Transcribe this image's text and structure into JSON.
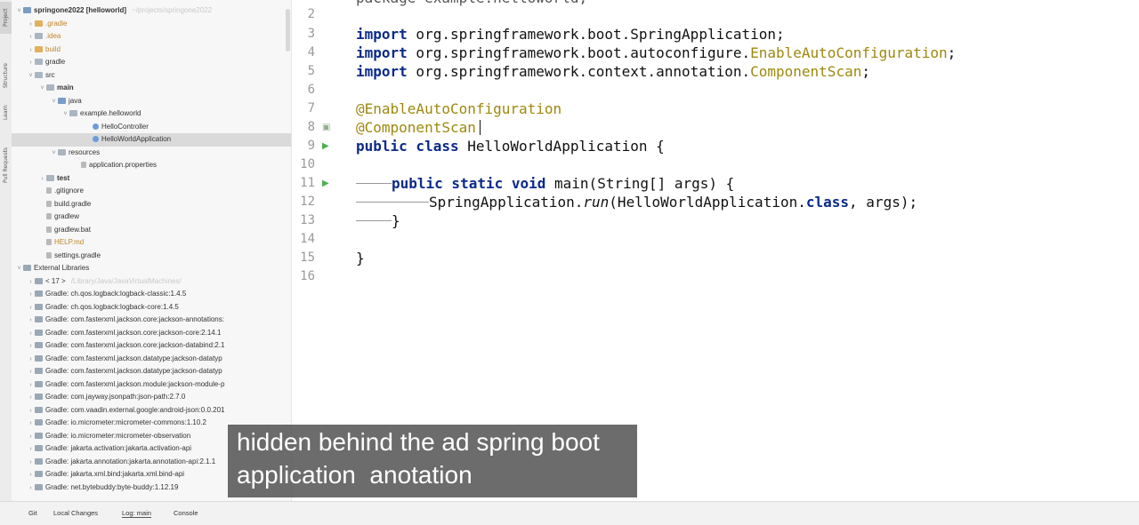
{
  "sidebar_tabs": [
    "Project",
    "Structure",
    "Learn",
    "Pull Requests"
  ],
  "project_tree": [
    {
      "label": "springone2022 [helloworld]",
      "extra": "~/projects/springone2022",
      "bold": true,
      "chevron": "v",
      "indent": 0,
      "icon": "folder-b"
    },
    {
      "label": ".gradle",
      "chevron": ">",
      "indent": 1,
      "icon": "folder-o",
      "faded": true
    },
    {
      "label": ".idea",
      "chevron": ">",
      "indent": 1,
      "icon": "folder",
      "faded": true
    },
    {
      "label": "build",
      "chevron": ">",
      "indent": 1,
      "icon": "folder-o",
      "faded": true
    },
    {
      "label": "gradle",
      "chevron": ">",
      "indent": 1,
      "icon": "folder"
    },
    {
      "label": "src",
      "chevron": "v",
      "indent": 1,
      "icon": "folder"
    },
    {
      "label": "main",
      "bold": true,
      "chevron": "v",
      "indent": 2,
      "icon": "folder"
    },
    {
      "label": "java",
      "chevron": "v",
      "indent": 3,
      "icon": "folder-b"
    },
    {
      "label": "example.helloworld",
      "chevron": "v",
      "indent": 4,
      "icon": "folder"
    },
    {
      "label": "HelloController",
      "indent": 6,
      "icon": "class"
    },
    {
      "label": "HelloWorldApplication",
      "indent": 6,
      "icon": "class",
      "selected": true
    },
    {
      "label": "resources",
      "chevron": "v",
      "indent": 3,
      "icon": "folder"
    },
    {
      "label": "application.properties",
      "indent": 5,
      "icon": "file"
    },
    {
      "label": "test",
      "bold": true,
      "chevron": ">",
      "indent": 2,
      "icon": "folder"
    },
    {
      "label": ".gitignore",
      "indent": 2,
      "icon": "file"
    },
    {
      "label": "build.gradle",
      "indent": 2,
      "icon": "file"
    },
    {
      "label": "gradlew",
      "indent": 2,
      "icon": "file"
    },
    {
      "label": "gradlew.bat",
      "indent": 2,
      "icon": "file"
    },
    {
      "label": "HELP.md",
      "indent": 2,
      "icon": "file",
      "faded": true
    },
    {
      "label": "settings.gradle",
      "indent": 2,
      "icon": "file"
    },
    {
      "label": "External Libraries",
      "chevron": "v",
      "indent": 0,
      "icon": "lib"
    },
    {
      "label": "< 17 >",
      "extra": "/Library/Java/JavaVirtualMachines/",
      "chevron": ">",
      "indent": 1,
      "icon": "lib"
    },
    {
      "label": "Gradle: ch.qos.logback:logback-classic:1.4.5",
      "chevron": ">",
      "indent": 1,
      "icon": "lib"
    },
    {
      "label": "Gradle: ch.qos.logback:logback-core:1.4.5",
      "chevron": ">",
      "indent": 1,
      "icon": "lib"
    },
    {
      "label": "Gradle: com.fasterxml.jackson.core:jackson-annotations:",
      "chevron": ">",
      "indent": 1,
      "icon": "lib"
    },
    {
      "label": "Gradle: com.fasterxml.jackson.core:jackson-core:2.14.1",
      "chevron": ">",
      "indent": 1,
      "icon": "lib"
    },
    {
      "label": "Gradle: com.fasterxml.jackson.core:jackson-databind:2.1",
      "chevron": ">",
      "indent": 1,
      "icon": "lib"
    },
    {
      "label": "Gradle: com.fasterxml.jackson.datatype:jackson-datatyp",
      "chevron": ">",
      "indent": 1,
      "icon": "lib"
    },
    {
      "label": "Gradle: com.fasterxml.jackson.datatype:jackson-datatyp",
      "chevron": ">",
      "indent": 1,
      "icon": "lib"
    },
    {
      "label": "Gradle: com.fasterxml.jackson.module:jackson-module-p",
      "chevron": ">",
      "indent": 1,
      "icon": "lib"
    },
    {
      "label": "Gradle: com.jayway.jsonpath:json-path:2.7.0",
      "chevron": ">",
      "indent": 1,
      "icon": "lib"
    },
    {
      "label": "Gradle: com.vaadin.external.google:android-json:0.0.201",
      "chevron": ">",
      "indent": 1,
      "icon": "lib"
    },
    {
      "label": "Gradle: io.micrometer:micrometer-commons:1.10.2",
      "chevron": ">",
      "indent": 1,
      "icon": "lib"
    },
    {
      "label": "Gradle: io.micrometer:micrometer-observation",
      "chevron": ">",
      "indent": 1,
      "icon": "lib"
    },
    {
      "label": "Gradle: jakarta.activation:jakarta.activation-api",
      "chevron": ">",
      "indent": 1,
      "icon": "lib"
    },
    {
      "label": "Gradle: jakarta.annotation:jakarta.annotation-api:2.1.1",
      "chevron": ">",
      "indent": 1,
      "icon": "lib"
    },
    {
      "label": "Gradle: jakarta.xml.bind:jakarta.xml.bind-api",
      "chevron": ">",
      "indent": 1,
      "icon": "lib"
    },
    {
      "label": "Gradle: net.bytebuddy:byte-buddy:1.12.19",
      "chevron": ">",
      "indent": 1,
      "icon": "lib"
    }
  ],
  "editor": {
    "line_numbers": [
      "2",
      "3",
      "4",
      "5",
      "6",
      "7",
      "8",
      "9",
      "10",
      "11",
      "12",
      "13",
      "14",
      "15",
      "16"
    ],
    "top_partial": "package example.helloworld;",
    "line3": {
      "kw": "import",
      "text": " org.springframework.boot.SpringApplication;"
    },
    "line4": {
      "kw": "import",
      "text": " org.springframework.boot.autoconfigure.",
      "cls": "EnableAutoConfiguration",
      "end": ";"
    },
    "line5": {
      "kw": "import",
      "text": " org.springframework.context.annotation.",
      "cls": "ComponentScan",
      "end": ";"
    },
    "line7": "@EnableAutoConfiguration",
    "line8": "@ComponentScan",
    "line9": {
      "kw": "public class",
      "text": " HelloWorldApplication {"
    },
    "line11": {
      "kw": "public static void",
      "text": " main(String[] args) {"
    },
    "line12": {
      "a": "SpringApplication.",
      "b": "run",
      "c": "(HelloWorldApplication.",
      "kw": "class",
      "d": ", args);"
    },
    "line13": "}",
    "line15": "}"
  },
  "bottom_tabs": [
    "Git",
    "Local Changes",
    "Log: main",
    "Console"
  ],
  "caption": {
    "line1": "hidden behind the ad spring boot",
    "line2": "application  anotation"
  },
  "colors": {
    "keyword": "#0b2a8a",
    "annotation": "#9e880d",
    "run_gutter": "#4caf50",
    "caption_bg": "#545454"
  }
}
